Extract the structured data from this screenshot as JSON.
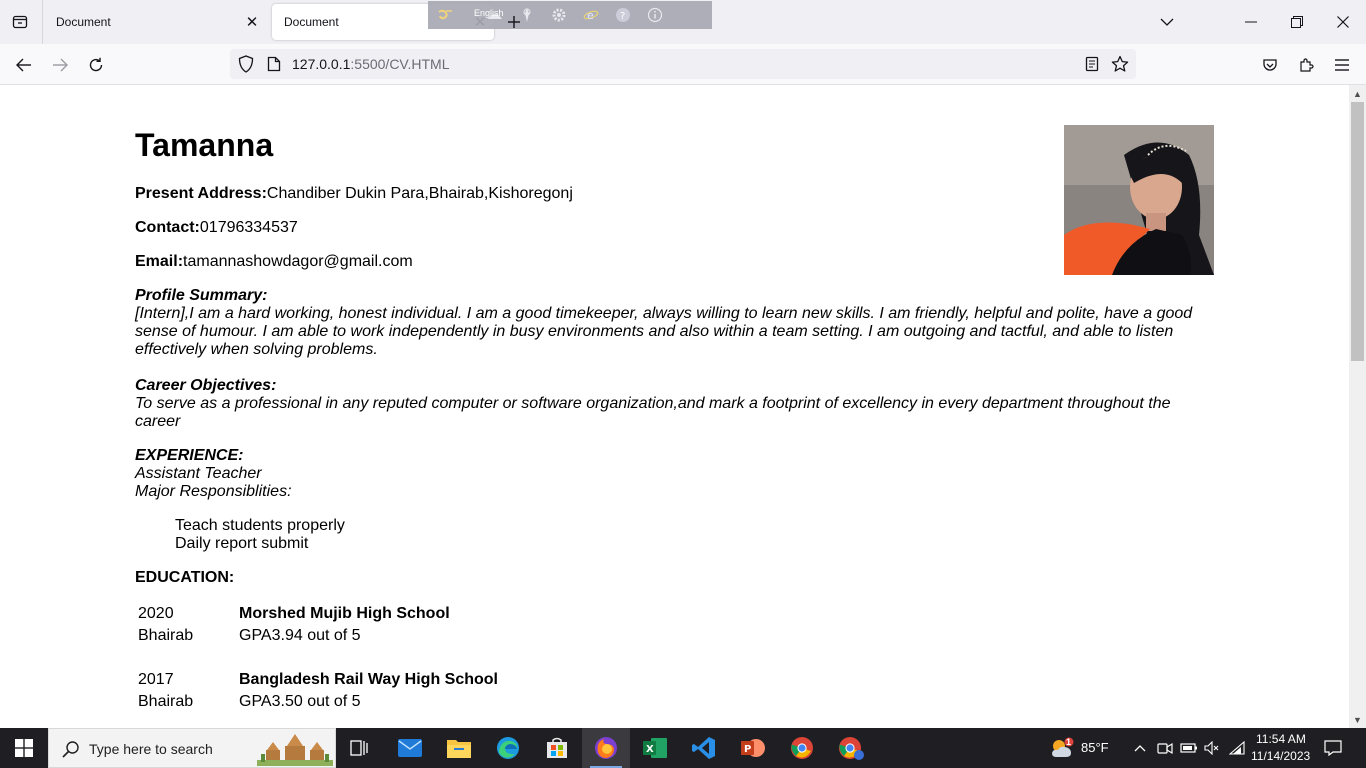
{
  "browser": {
    "tabs": [
      {
        "title": "Document",
        "close": "✕"
      },
      {
        "title": "Document",
        "close": "✕"
      }
    ],
    "ime": {
      "language": "English"
    },
    "url": {
      "host": "127.0.0.1",
      "rest": ":5500/CV.HTML"
    }
  },
  "cv": {
    "name": "Tamanna",
    "address": {
      "label": "Present Address:",
      "value": "Chandiber Dukin Para,Bhairab,Kishoregonj"
    },
    "contact": {
      "label": "Contact:",
      "value": "01796334537"
    },
    "email": {
      "label": "Email:",
      "value": "tamannashowdagor@gmail.com"
    },
    "profile": {
      "heading": "Profile Summary:",
      "text": "[Intern],I am a hard working, honest individual. I am a good timekeeper, always willing to learn new skills. I am friendly, helpful and polite, have a good sense of humour. I am able to work independently in busy environments and also within a team setting. I am outgoing and tactful, and able to listen effectively when solving problems."
    },
    "career": {
      "heading": "Career Objectives:",
      "text": "To serve as a professional in any reputed computer or software organization,and mark a footprint of excellency in every department throughout the career"
    },
    "experience": {
      "heading": "EXPERIENCE:",
      "role": "Assistant Teacher",
      "resp_label": "Major Responsiblities:",
      "items": [
        "Teach students properly",
        "Daily report submit"
      ]
    },
    "education": {
      "heading": "EDUCATION:",
      "entries": [
        {
          "year": "2020",
          "school": "Morshed Mujib High School",
          "place": "Bhairab",
          "result": "GPA3.94 out of 5"
        },
        {
          "year": "2017",
          "school": "Bangladesh Rail Way High School",
          "place": "Bhairab",
          "result": "GPA3.50 out of 5"
        }
      ]
    }
  },
  "taskbar": {
    "search_placeholder": "Type here to search",
    "weather": "85°F",
    "weather_badge": "1",
    "time": "11:54 AM",
    "date": "11/14/2023"
  }
}
